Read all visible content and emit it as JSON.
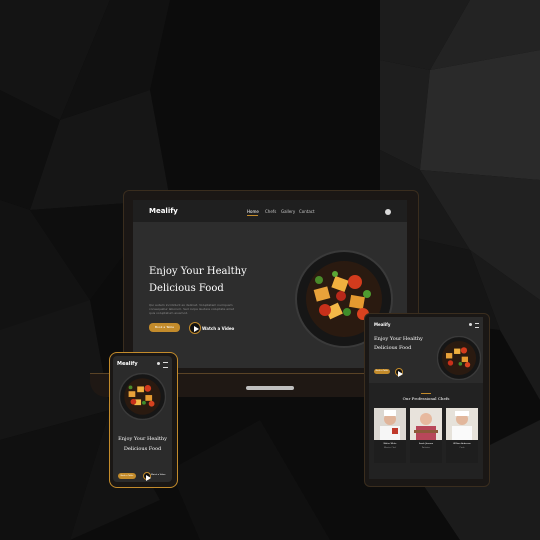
{
  "brand": {
    "name": "Mealify"
  },
  "nav": {
    "links": [
      "Home",
      "Chefs",
      "Gallery",
      "Contact"
    ]
  },
  "hero": {
    "title_line1": "Enjoy Your Healthy",
    "title_line2": "Delicious Food",
    "description_line1": "Qui autem incididunt ex deliniet. Voluptatem numquam",
    "description_line2": "consequatur laborum. Sed culpa laudare voluptate amet",
    "description_line3": "quis voluptatum eiusmod.",
    "primary_button": "Book a Table",
    "video_button": "Watch a Video"
  },
  "tablet": {
    "section_title": "Our Professional Chefs",
    "chefs": [
      {
        "name": "Walter White",
        "role": "Master Chef"
      },
      {
        "name": "Sarah Jhonson",
        "role": "Patissier"
      },
      {
        "name": "William Anderson",
        "role": "Cook"
      }
    ]
  },
  "colors": {
    "accent": "#c38b2b",
    "background": "#0d0d0d",
    "screen": "#2d2d2d"
  }
}
